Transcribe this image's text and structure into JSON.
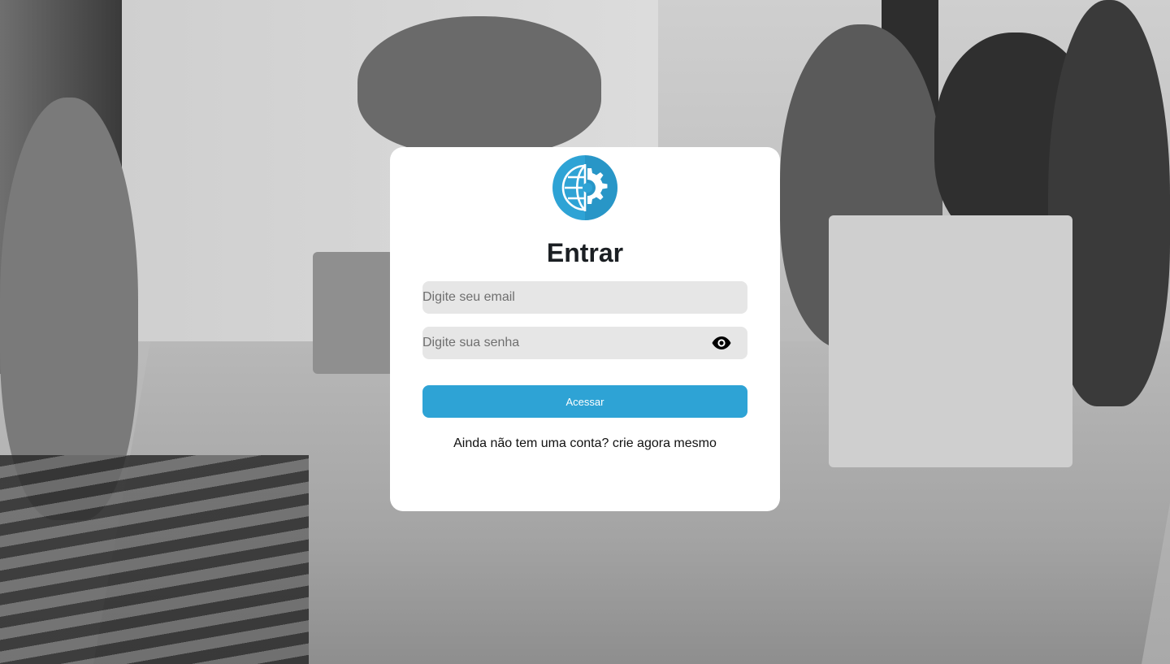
{
  "login": {
    "title": "Entrar",
    "email_placeholder": "Digite seu email",
    "password_placeholder": "Digite sua senha",
    "submit_label": "Acessar",
    "signup_prompt": "Ainda não tem uma conta?",
    "signup_link": "crie agora mesmo"
  },
  "icons": {
    "logo": "globe-gear-logo",
    "password_toggle": "eye-icon"
  },
  "colors": {
    "accent": "#2ea3d5",
    "input_bg": "#e6e6e6",
    "card_bg": "#ffffff",
    "title": "#1b1f23"
  }
}
